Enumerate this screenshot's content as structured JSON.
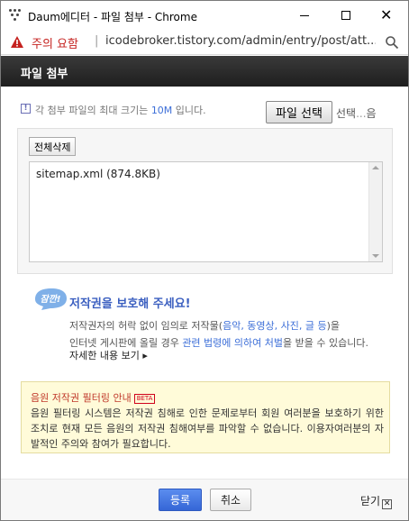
{
  "window": {
    "title": "Daum에디터 - 파일 첨부 - Chrome",
    "minimize_glyph": "",
    "close_glyph": "✕"
  },
  "address": {
    "warning_label": "주의 요함",
    "separator": "|",
    "url": "icodebroker.tistory.com/admin/entry/post/att..."
  },
  "header": {
    "title": "파일 첨부"
  },
  "notice": {
    "icon_glyph": "!",
    "text_before": "각 첨부 파일의 최대 크기는 ",
    "limit": "10M",
    "text_after": " 입니다."
  },
  "file_input": {
    "button_label": "파일 선택",
    "status_prefix": "선택",
    "status_muted": "...",
    "status_suffix": "음"
  },
  "file_panel": {
    "delete_all_label": "전체삭제",
    "files": [
      "sitemap.xml (874.8KB)"
    ]
  },
  "copyright": {
    "badge_text": "잠깐!",
    "title": "저작권을 보호해 주세요!",
    "line1_a": "저작권자의 허락 없이 임의로 저작물(",
    "line1_hl": "음악, 동영상, 사진, 글 등",
    "line1_b": ")을",
    "line2_a": "인터넷 게시판에 올릴 경우 ",
    "line2_hl": "관련 법령에 의하여 처벌",
    "line2_b": "을 받을 수 있습니다.",
    "detail_link": "자세한 내용 보기 ▸"
  },
  "filter": {
    "title": "음원 저작권 필터링 안내",
    "beta": "BETA",
    "body": "음원 필터링 시스템은 저작권 침해로 인한 문제로부터 회원 여러분을 보호하기 위한 조치로 현재 모든 음원의 저작권 침해여부를 파악할 수 없습니다. 이용자여러분의 자발적인 주의와 참여가 필요합니다."
  },
  "footer": {
    "register_label": "등록",
    "cancel_label": "취소",
    "close_label": "닫기",
    "close_glyph": "✕"
  },
  "colors": {
    "accent_blue": "#3d6fd8",
    "warning_red": "#c5221f",
    "header_dark": "#2a2a2a",
    "filter_bg": "#fffbd9"
  }
}
